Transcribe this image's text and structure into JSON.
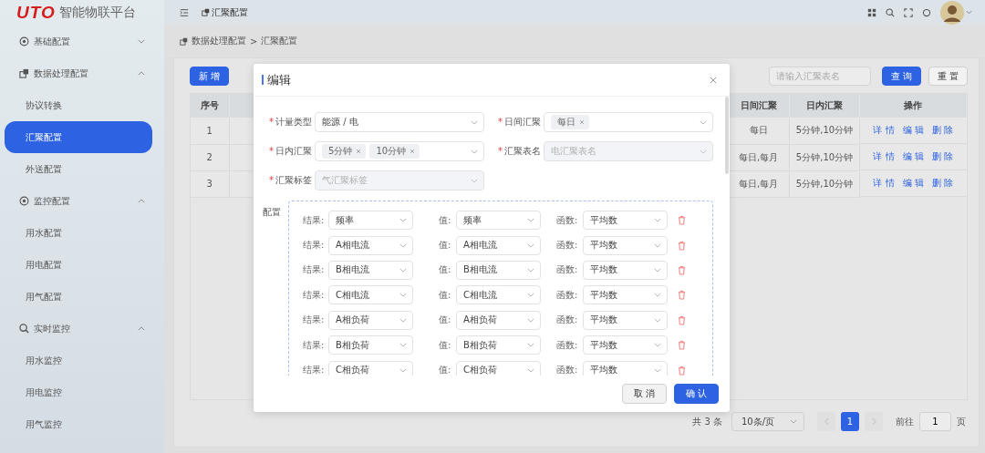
{
  "logo": {
    "brand": "UTO",
    "title": "智能物联平台"
  },
  "sidebar": {
    "items": [
      {
        "label": "基础配置",
        "expanded": false,
        "selected": false
      },
      {
        "label": "数据处理配置",
        "expanded": true,
        "selected": false,
        "children": [
          {
            "label": "协议转换",
            "selected": false
          },
          {
            "label": "汇聚配置",
            "selected": true
          },
          {
            "label": "外送配置",
            "selected": false
          }
        ]
      },
      {
        "label": "监控配置",
        "expanded": true,
        "selected": false,
        "children": [
          {
            "label": "用水配置",
            "selected": false
          },
          {
            "label": "用电配置",
            "selected": false
          },
          {
            "label": "用气配置",
            "selected": false
          }
        ]
      },
      {
        "label": "实时监控",
        "expanded": true,
        "selected": false,
        "children": [
          {
            "label": "用水监控",
            "selected": false
          },
          {
            "label": "用电监控",
            "selected": false
          },
          {
            "label": "用气监控",
            "selected": false
          }
        ]
      }
    ]
  },
  "header": {
    "tab": "汇聚配置"
  },
  "breadcrumb": {
    "items": [
      "数据处理配置",
      "汇聚配置"
    ],
    "separator": ">"
  },
  "toolbar": {
    "add": "新 增",
    "search": {
      "placeholder": "请输入汇聚表名"
    },
    "query": "查 询",
    "reset": "重 置"
  },
  "table": {
    "columns": [
      "序号",
      "",
      "日间汇聚",
      "日内汇聚",
      "操作"
    ],
    "rows": [
      {
        "index": "1",
        "daily": "每日",
        "intraday": "5分钟,10分钟",
        "actions": [
          "详 情",
          "编 辑",
          "删 除"
        ]
      },
      {
        "index": "2",
        "daily": "每日,每月",
        "intraday": "5分钟,10分钟",
        "actions": [
          "详 情",
          "编 辑",
          "删 除"
        ]
      },
      {
        "index": "3",
        "daily": "每日,每月",
        "intraday": "5分钟,10分钟",
        "actions": [
          "详 情",
          "编 辑",
          "删 除"
        ]
      }
    ]
  },
  "pagination": {
    "total": "共 3 条",
    "page_size": "10条/页",
    "pages": [
      {
        "label": "1",
        "selected": true
      }
    ],
    "goto_label": "前往",
    "goto_value": "1",
    "page_unit": "页"
  },
  "modal": {
    "title": "编辑",
    "fields": [
      {
        "kind": "select",
        "label": "计量类型",
        "required_mark": "*",
        "value": "能源 / 电"
      },
      {
        "kind": "tags",
        "label": "日间汇聚",
        "required_mark": "*",
        "tags": [
          "每日"
        ]
      },
      {
        "kind": "tags",
        "label": "日内汇聚",
        "required_mark": "*",
        "tags": [
          "5分钟",
          "10分钟"
        ]
      },
      {
        "kind": "disabled",
        "label": "汇聚表名",
        "required_mark": "*",
        "placeholder": "电汇聚表名"
      },
      {
        "kind": "disabled",
        "label": "汇聚标签",
        "required_mark": "*",
        "placeholder": "气汇聚标签"
      }
    ],
    "config": {
      "label": "配置",
      "rows": [
        {
          "result_label": "结果:",
          "result": "频率",
          "value_label": "值:",
          "value": "频率",
          "func_label": "函数:",
          "func": "平均数"
        },
        {
          "result_label": "结果:",
          "result": "A相电流",
          "value_label": "值:",
          "value": "A相电流",
          "func_label": "函数:",
          "func": "平均数"
        },
        {
          "result_label": "结果:",
          "result": "B相电流",
          "value_label": "值:",
          "value": "B相电流",
          "func_label": "函数:",
          "func": "平均数"
        },
        {
          "result_label": "结果:",
          "result": "C相电流",
          "value_label": "值:",
          "value": "C相电流",
          "func_label": "函数:",
          "func": "平均数"
        },
        {
          "result_label": "结果:",
          "result": "A相负荷",
          "value_label": "值:",
          "value": "A相负荷",
          "func_label": "函数:",
          "func": "平均数"
        },
        {
          "result_label": "结果:",
          "result": "B相负荷",
          "value_label": "值:",
          "value": "B相负荷",
          "func_label": "函数:",
          "func": "平均数"
        },
        {
          "result_label": "结果:",
          "result": "C相负荷",
          "value_label": "值:",
          "value": "C相负荷",
          "func_label": "函数:",
          "func": "平均数"
        }
      ]
    },
    "cancel": "取 消",
    "confirm": "确 认"
  }
}
